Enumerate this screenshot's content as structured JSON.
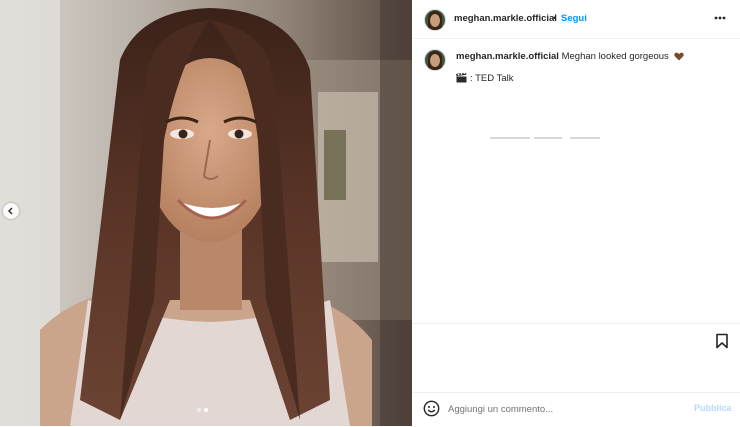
{
  "post": {
    "username": "meghan.markle.official",
    "separator": "•",
    "follow_label": "Segui",
    "more_icon": "more-horizontal-icon"
  },
  "caption": {
    "username": "meghan.markle.official",
    "text": "Meghan looked gorgeous",
    "emoji": "brown-heart",
    "line2_emoji": "clapper-board",
    "line2_text": ": TED Talk"
  },
  "media": {
    "carousel_dots": 2,
    "active_dot": 1
  },
  "comment": {
    "placeholder": "Aggiungi un commento...",
    "publish_label": "Pubblica"
  },
  "colors": {
    "accent": "#0095f6",
    "publish_disabled": "#b3dbff",
    "text": "#262626",
    "border": "#efefef"
  }
}
